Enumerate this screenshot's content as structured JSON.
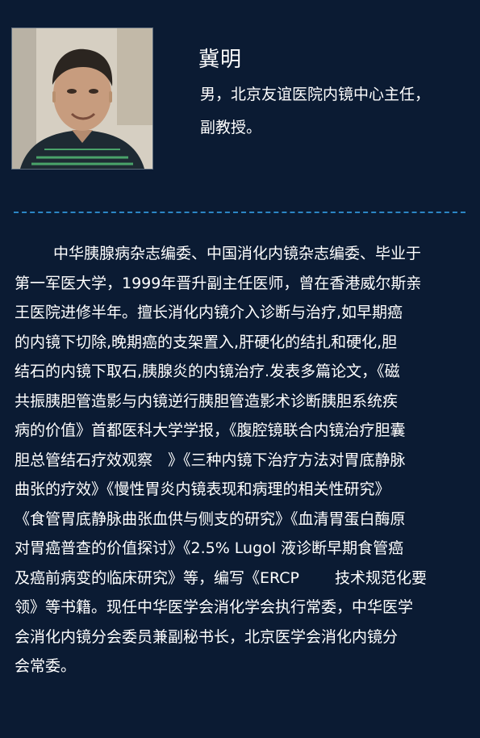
{
  "profile": {
    "name": "冀明",
    "title_lines": [
      "男，北京友谊医院内镜中心主任，",
      "副教授。"
    ]
  },
  "bio": {
    "lines": [
      "中华胰腺病杂志编委、中国消化内镜杂志编委、毕业于",
      "第一军医大学，1999年晋升副主任医师，曾在香港威尔斯亲",
      "王医院进修半年。擅长消化内镜介入诊断与治疗,如早期癌",
      "的内镜下切除,晚期癌的支架置入,肝硬化的结扎和硬化,胆",
      "结石的内镜下取石,胰腺炎的内镜治疗.发表多篇论文，《磁",
      "共振胰胆管造影与内镜逆行胰胆管造影术诊断胰胆系统疾",
      "病的价值》首都医科大学学报，《腹腔镜联合内镜治疗胆囊",
      "胆总管结石疗效观察　》《三种内镜下治疗方法对胃底静脉",
      "曲张的疗效》《慢性胃炎内镜表现和病理的相关性研究》",
      "《食管胃底静脉曲张血供与侧支的研究》《血清胃蛋白酶原",
      "对胃癌普查的价值探讨》《2.5%  Lugol  液诊断早期食管癌",
      "及癌前病变的临床研究》等，编写《ERCP　　 技术规范化要",
      "领》等书籍。现任中华医学会消化学会执行常委，中华医学",
      "会消化内镜分会委员兼副秘书长，北京医学会消化内镜分",
      "会常委。"
    ]
  }
}
